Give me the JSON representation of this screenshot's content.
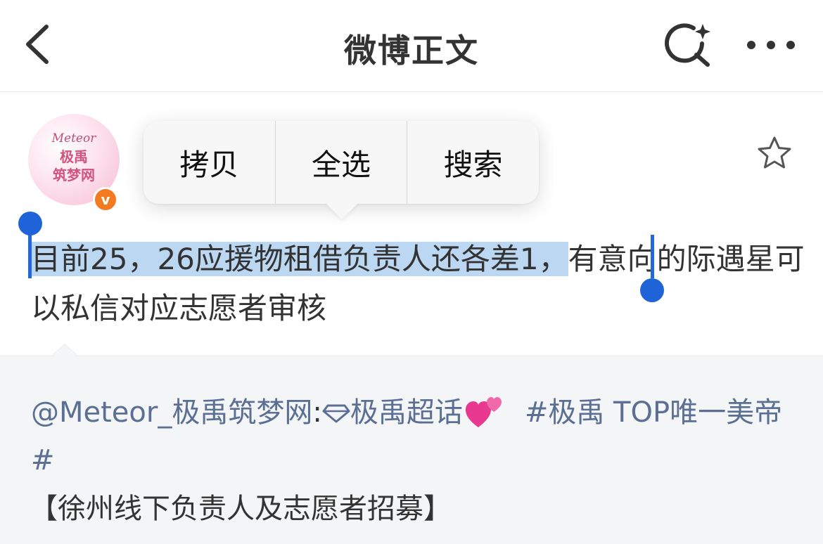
{
  "nav": {
    "title": "微博正文",
    "back_icon": "chevron-left-icon",
    "search_icon": "search-sparkle-icon",
    "more_icon": "more-dots-icon"
  },
  "author": {
    "avatar_line1": "Meteor",
    "avatar_line2": "极禹",
    "avatar_line3": "筑梦网",
    "verified_glyph": "v",
    "verified_color": "#f37a1f"
  },
  "context_menu": {
    "items": [
      "拷贝",
      "全选",
      "搜索"
    ]
  },
  "post": {
    "selected_text": "目前25，26应援物租借负责人还各差1，",
    "rest_text": "有意向的际遇星可以私信对应志愿者审核",
    "selection_color": "#bcd7f2",
    "handle_color": "#1f63d8"
  },
  "repost": {
    "mention": "@Meteor_极禹筑梦网",
    "colon": ":",
    "super_topic": "极禹超话",
    "hashtag": "#极禹 TOP唯一美帝#",
    "title": "【徐州线下负责人及志愿者招募】",
    "link_color": "#5b6f94"
  }
}
